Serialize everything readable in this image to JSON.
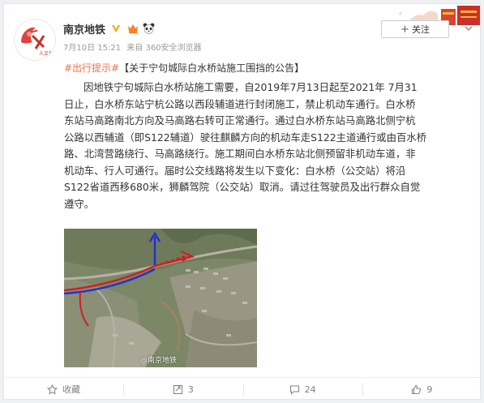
{
  "post": {
    "user_name": "南京地铁",
    "meta_date": "7月10日 15:21",
    "meta_source": "来自 360安全浏览器",
    "follow_label": "关注",
    "topic": "#出行提示#",
    "title": "【关于宁句城际白水桥站施工围挡的公告】",
    "body_lines": [
      "因地铁宁句城际白水桥站施工需要，自2019年7月13日起至2021年 7月31",
      "日止，白水桥东站宁杭公路以西段辅道进行封闭施工，禁止机动车通行。白水桥",
      "东站马高路南北方向及马高路右转可正常通行。通过白水桥东站马高路北侧宁杭",
      "公路以西辅道（即S122辅道）驶往麒麟方向的机动车走S122主道通行或由百水桥",
      "路、北湾营路绕行、马高路绕行。施工期间白水桥东站北侧预留非机动车道，非",
      "机动车、行人可通行。届时公交线路将发生以下变化：白水桥（公交站）将沿",
      "S122省道西移680米，狮麟驾院（公交站）取消。请过往驾驶员及出行群众自觉",
      "遵守。"
    ],
    "image_watermark": "@南京地铁",
    "avatar_text": "人文地铁"
  },
  "footer": {
    "favorite_label": "收藏",
    "repost_count": "3",
    "comment_count": "24",
    "like_count": "9"
  },
  "colors": {
    "topic": "#eb7350",
    "verified": "#ffa300"
  },
  "icons": {
    "verified": "verified-v-icon",
    "badges": [
      "vip-icon",
      "panda-icon"
    ],
    "more": "chevron-down-icon",
    "favorite": "star-icon",
    "repost": "repost-icon",
    "comment": "comment-icon",
    "like": "thumb-up-icon"
  }
}
